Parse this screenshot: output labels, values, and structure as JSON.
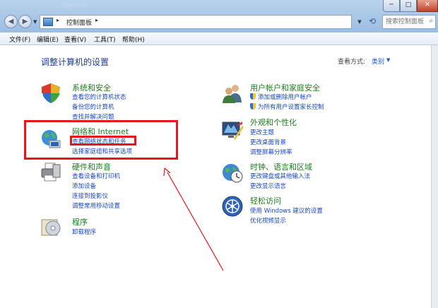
{
  "window": {
    "faint_title": "Explorer",
    "min_glyph": "─",
    "max_glyph": "□",
    "close_glyph": "✕"
  },
  "nav": {
    "back_glyph": "◀",
    "forward_glyph": "▶",
    "dropdown_glyph": "▼",
    "breadcrumb_sep": "▸",
    "breadcrumb": "控制面板",
    "refresh_glyph": "⟲",
    "search_placeholder": "搜索控制面板",
    "search_glyph": "⌕"
  },
  "menu": [
    "文件(F)",
    "编辑(E)",
    "查看(V)",
    "工具(T)",
    "帮助(H)"
  ],
  "main": {
    "title": "调整计算机的设置",
    "view_by_label": "查看方式:",
    "view_by_value": "类别",
    "view_by_caret": "▼"
  },
  "categories": {
    "system": {
      "title": "系统和安全",
      "links": [
        "查看您的计算机状态",
        "备份您的计算机",
        "查找并解决问题"
      ]
    },
    "network": {
      "title": "网络和 Internet",
      "links": [
        "查看网络状态和任务",
        "选择家庭组和共享选项"
      ]
    },
    "hardware": {
      "title": "硬件和声音",
      "links": [
        "查看设备和打印机",
        "添加设备",
        "连接到投影仪",
        "调整常用移动设置"
      ]
    },
    "programs": {
      "title": "程序",
      "links": [
        "卸载程序"
      ]
    },
    "users": {
      "title": "用户帐户和家庭安全",
      "links": [
        "添加或删除用户帐户",
        "为所有用户设置家长控制"
      ]
    },
    "appearance": {
      "title": "外观和个性化",
      "links": [
        "更改主题",
        "更改桌面背景",
        "调整屏幕分辨率"
      ]
    },
    "clock": {
      "title": "时钟、语言和区域",
      "links": [
        "更改键盘或其他输入法",
        "更改显示语言"
      ]
    },
    "ease": {
      "title": "轻松访问",
      "links": [
        "使用 Windows 建议的设置",
        "优化视频显示"
      ]
    }
  },
  "colors": {
    "category_title": "#1e7d1e",
    "link": "#1747c4",
    "annotation_red": "#e8161c",
    "page_title": "#1e3d8f"
  }
}
